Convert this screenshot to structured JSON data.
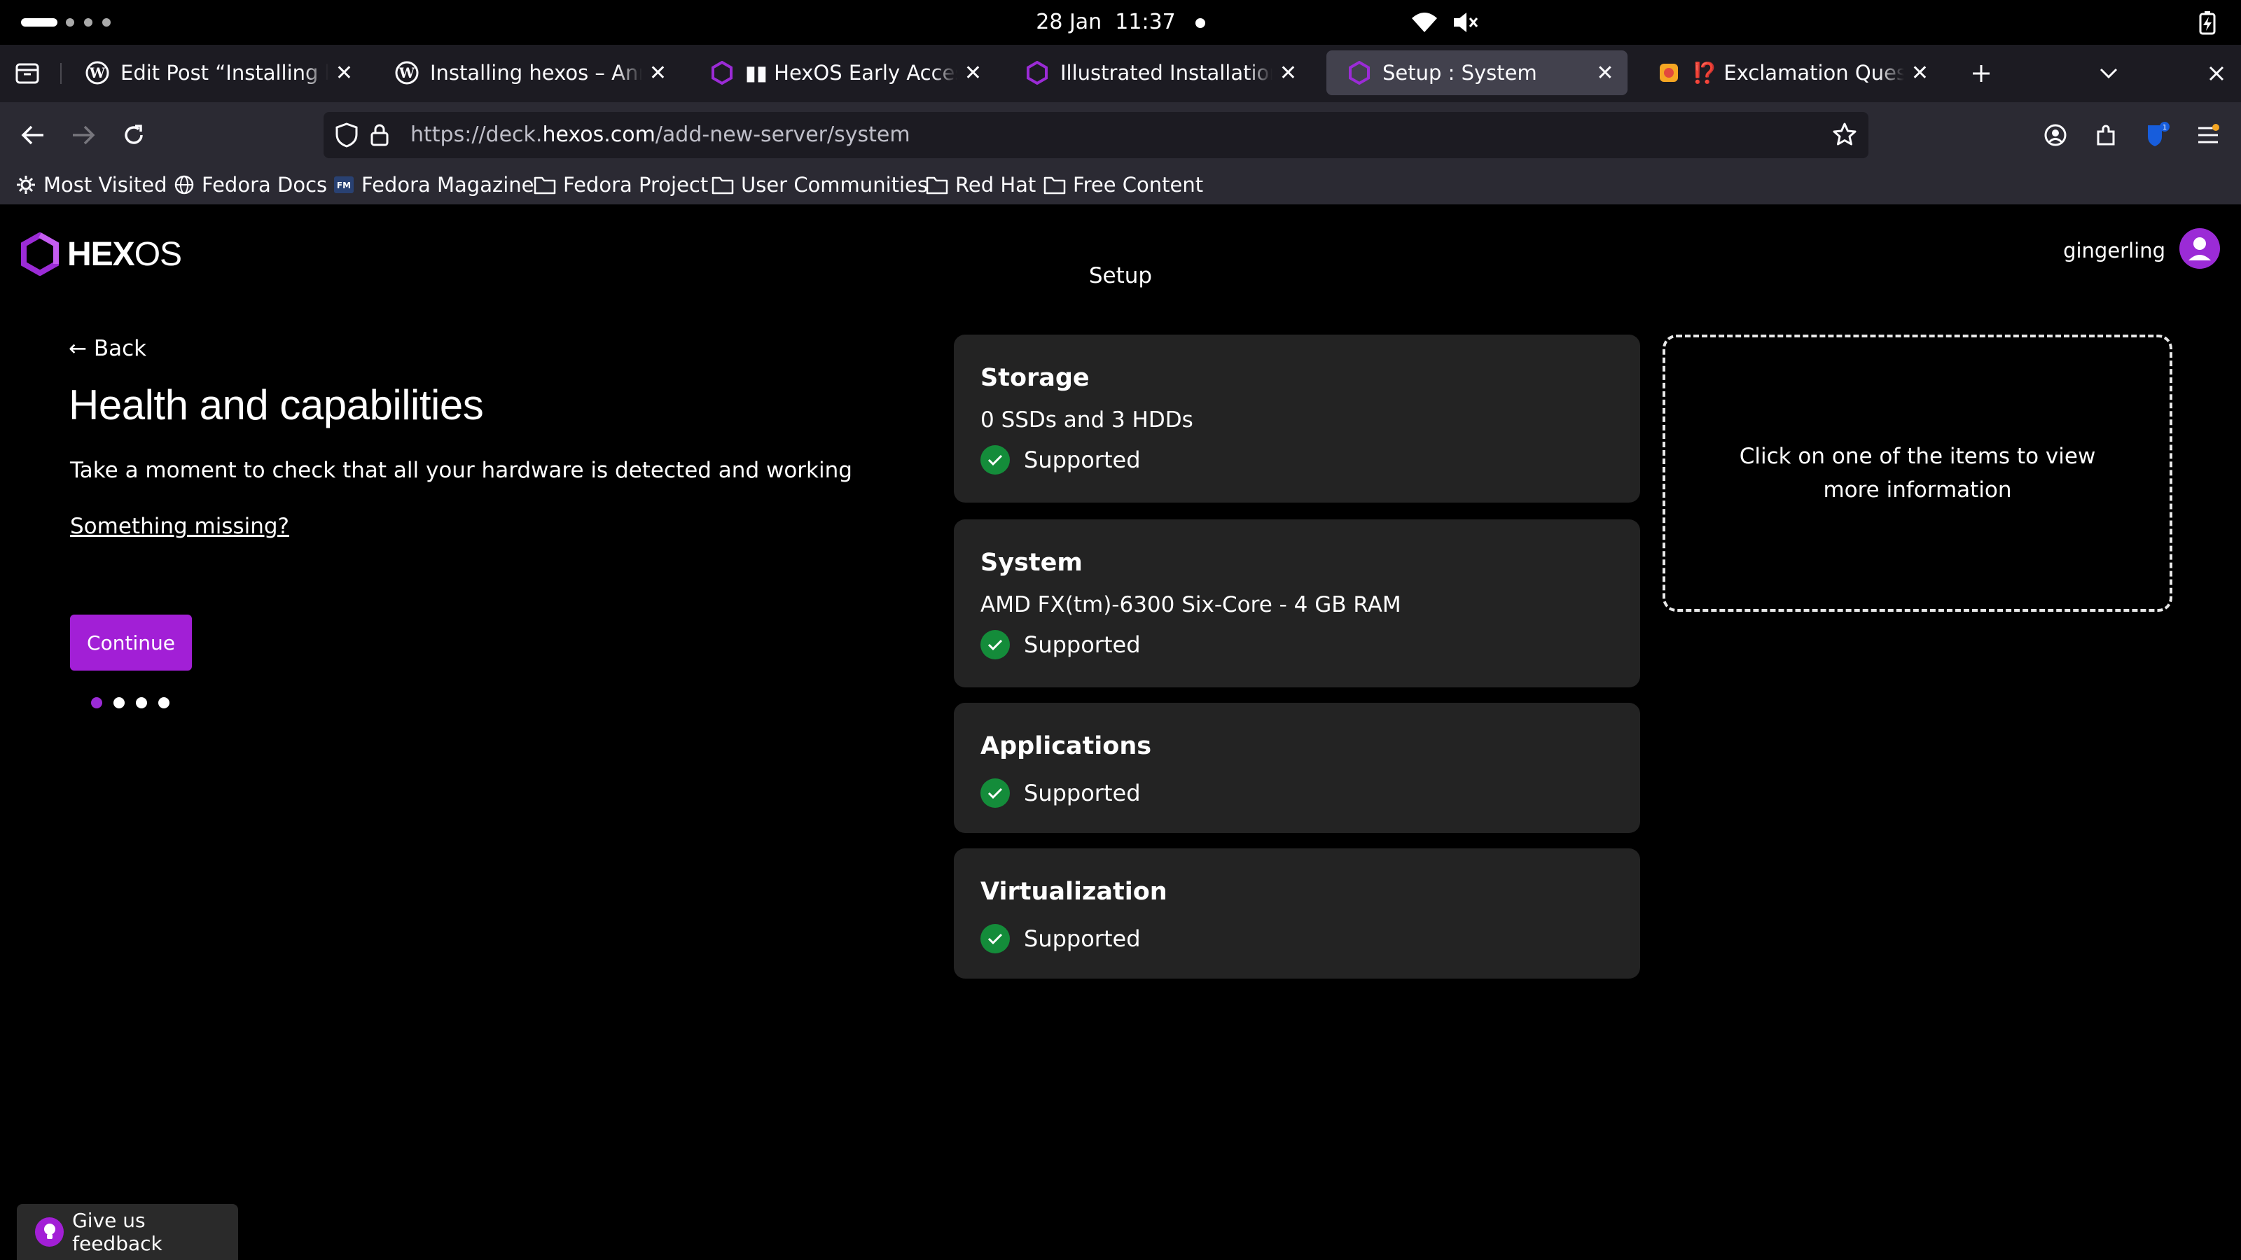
{
  "topbar": {
    "date": "28 Jan",
    "time": "11:37"
  },
  "tabs": [
    {
      "title": "Edit Post “Installing hexos",
      "favicon": "wordpress-icon"
    },
    {
      "title": "Installing hexos – Anna F",
      "favicon": "wordpress-icon"
    },
    {
      "title": "▮▮ HexOS Early Access Pr",
      "favicon": "hexos-icon"
    },
    {
      "title": "Illustrated Installation Gu",
      "favicon": "hexos-icon"
    },
    {
      "title": "Setup : System",
      "favicon": "hexos-icon",
      "active": true
    },
    {
      "title": "⁉️ Exclamation Question",
      "favicon": "emoji-icon"
    }
  ],
  "url": {
    "prefix": "https://deck.",
    "host": "hexos.com",
    "path": "/add-new-server/system"
  },
  "bookmarks": [
    {
      "label": "Most Visited",
      "icon": "gear-icon"
    },
    {
      "label": "Fedora Docs",
      "icon": "globe-icon"
    },
    {
      "label": "Fedora Magazine",
      "icon": "fm-icon"
    },
    {
      "label": "Fedora Project",
      "icon": "folder-icon"
    },
    {
      "label": "User Communities",
      "icon": "folder-icon"
    },
    {
      "label": "Red Hat",
      "icon": "folder-icon"
    },
    {
      "label": "Free Content",
      "icon": "folder-icon"
    }
  ],
  "header": {
    "logo_bold": "HEX",
    "logo_light": "OS",
    "setup_title": "Setup",
    "username": "gingerling"
  },
  "main": {
    "back_label": "← Back",
    "title": "Health and capabilities",
    "subtitle": "Take a moment to check that all your hardware is detected and working",
    "missing_link": "Something missing?",
    "continue_label": "Continue",
    "steps": 4,
    "current_step": 1
  },
  "cards": [
    {
      "title": "Storage",
      "detail": "0 SSDs and 3 HDDs",
      "status": "Supported"
    },
    {
      "title": "System",
      "detail": "AMD FX(tm)-6300 Six-Core - 4 GB RAM",
      "status": "Supported"
    },
    {
      "title": "Applications",
      "status": "Supported"
    },
    {
      "title": "Virtualization",
      "status": "Supported"
    }
  ],
  "info_panel": {
    "text": "Click on one of the items to view more information"
  },
  "feedback": {
    "label": "Give us feedback"
  },
  "colors": {
    "accent": "#a21fd6",
    "success": "#148c3a",
    "card_bg": "#232323",
    "tab_active": "#42414d"
  }
}
